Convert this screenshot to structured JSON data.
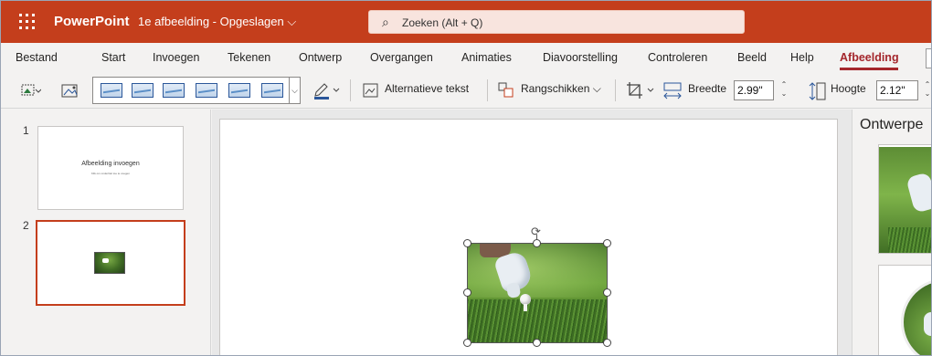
{
  "app": {
    "name": "PowerPoint",
    "doc_title": "1e afbeelding - Opgeslagen ⌵",
    "brand_color": "#c43e1c"
  },
  "search": {
    "placeholder": "Zoeken (Alt + Q)"
  },
  "tabs": [
    {
      "label": "Bestand"
    },
    {
      "label": "Start"
    },
    {
      "label": "Invoegen"
    },
    {
      "label": "Tekenen"
    },
    {
      "label": "Ontwerp"
    },
    {
      "label": "Overgangen"
    },
    {
      "label": "Animaties"
    },
    {
      "label": "Diavoorstelling"
    },
    {
      "label": "Controleren"
    },
    {
      "label": "Beeld"
    },
    {
      "label": "Help"
    },
    {
      "label": "Afbeelding",
      "active": true
    }
  ],
  "ribbon": {
    "alt_text_label": "Alternatieve tekst",
    "arrange_label": "Rangschikken ⌵",
    "width_label": "Breedte",
    "width_value": "2.99\"",
    "height_label": "Hoogte",
    "height_value": "2.12\"",
    "picture_styles_count": 6
  },
  "slides": [
    {
      "number": "1",
      "title": "Afbeelding invoegen",
      "subtitle": "Klik om ondertitel toe te voegen"
    },
    {
      "number": "2",
      "selected": true
    }
  ],
  "designer": {
    "title": "Ontwerpe"
  }
}
